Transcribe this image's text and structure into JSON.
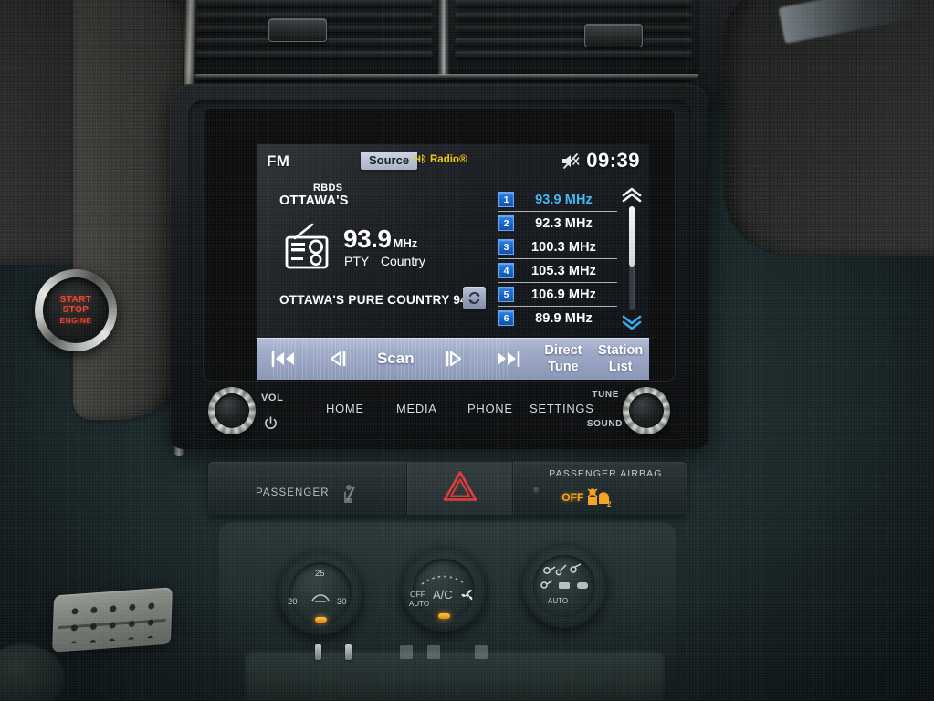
{
  "display": {
    "status_bar": {
      "band": "FM",
      "source_label": "Source",
      "hd_mark": "HD",
      "hd_word": "Radio®",
      "mute_icon": "mute-speaker-icon",
      "clock": "09:39"
    },
    "now_playing": {
      "rbds_tag": "RBDS",
      "station_short_name": "OTTAWA'S",
      "radio_icon": "radio-tuner-icon",
      "frequency": "93.9",
      "frequency_unit": "MHz",
      "pty_label": "PTY",
      "pty_value": "Country",
      "radio_text": "OTTAWA'S PURE COUNTRY 94",
      "refresh_icon": "refresh-icon"
    },
    "presets": [
      {
        "number": "1",
        "frequency": "93.9 MHz",
        "active": true
      },
      {
        "number": "2",
        "frequency": "92.3 MHz",
        "active": false
      },
      {
        "number": "3",
        "frequency": "100.3 MHz",
        "active": false
      },
      {
        "number": "4",
        "frequency": "105.3 MHz",
        "active": false
      },
      {
        "number": "5",
        "frequency": "106.9 MHz",
        "active": false
      },
      {
        "number": "6",
        "frequency": "89.9 MHz",
        "active": false
      }
    ],
    "scroll": {
      "up_icon": "chevron-double-up-icon",
      "down_icon": "chevron-double-down-icon"
    },
    "controls": [
      {
        "name": "previous-station",
        "icon": "skip-back-icon",
        "label": ""
      },
      {
        "name": "tune-down",
        "icon": "seek-down-icon",
        "label": ""
      },
      {
        "name": "scan",
        "icon": "",
        "label": "Scan"
      },
      {
        "name": "tune-up",
        "icon": "seek-up-icon",
        "label": ""
      },
      {
        "name": "next-station",
        "icon": "skip-forward-icon",
        "label": ""
      },
      {
        "name": "direct-tune",
        "icon": "",
        "label_line1": "Direct",
        "label_line2": "Tune"
      },
      {
        "name": "station-list",
        "icon": "",
        "label_line1": "Station",
        "label_line2": "List"
      }
    ]
  },
  "hardware": {
    "vol_label": "VOL",
    "power_icon": "power-icon",
    "tune_label": "TUNE",
    "sound_label": "SOUND",
    "buttons": [
      {
        "name": "home",
        "label": "HOME"
      },
      {
        "name": "media",
        "label": "MEDIA"
      },
      {
        "name": "phone",
        "label": "PHONE"
      },
      {
        "name": "settings",
        "label": "SETTINGS"
      }
    ]
  },
  "airbag_panel": {
    "passenger_label": "PASSENGER",
    "seatbelt_icon": "seatbelt-warning-icon",
    "hazard_icon": "hazard-triangle-icon",
    "airbag_title": "PASSENGER  AIRBAG",
    "off_label": "OFF",
    "airbag_off_icon": "passenger-airbag-off-icon"
  },
  "hvac": {
    "temperature_knob": {
      "name": "temperature-knob",
      "ticks": [
        "20",
        "25",
        "30"
      ],
      "icon": "windshield-defog-icon"
    },
    "fan_knob": {
      "name": "fan-speed-knob",
      "off_label": "OFF",
      "auto_label": "AUTO",
      "ac_label": "A/C",
      "fan_icon": "fan-icon"
    },
    "mode_knob": {
      "name": "airflow-mode-knob",
      "auto_label": "AUTO",
      "icons": [
        "vent-face-icon",
        "vent-feet-icon",
        "vent-face-feet-icon",
        "defrost-rear-icon",
        "defrost-front-icon"
      ]
    }
  },
  "engine_start": {
    "line1": "START",
    "line2": "STOP",
    "line3": "ENGINE"
  },
  "colors": {
    "accent_cyan": "#3fb7f2",
    "preset_blue": "#1763c9",
    "control_bar": "#9ea9c6",
    "hd_yellow": "#f2c40a",
    "airbag_amber": "#f5a321",
    "start_red": "#e8452f"
  }
}
